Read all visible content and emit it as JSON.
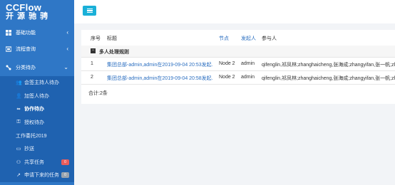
{
  "brand": {
    "line1": "CCFlow",
    "line2": "开 源 驰 骋"
  },
  "sidebar": {
    "top_items": [
      {
        "label": "基础功能",
        "icon": "grid-icon"
      },
      {
        "label": "流程查询",
        "icon": "search-flow-icon"
      },
      {
        "label": "分类待办",
        "icon": "flow-icon"
      }
    ],
    "sub_items": [
      {
        "label": "会签主持人待办",
        "icon": "user-group-icon"
      },
      {
        "label": "加签人待办",
        "icon": "user-add-icon"
      },
      {
        "label": "协作待办",
        "icon": "link-icon"
      },
      {
        "label": "授权待办",
        "icon": "key-icon"
      },
      {
        "label": "工作委托2019",
        "icon": ""
      },
      {
        "label": "抄送",
        "icon": "copy-icon"
      },
      {
        "label": "共享任务",
        "icon": "share-icon",
        "badge": "0",
        "badge_color": "#e85c5c"
      },
      {
        "label": "申请下来的任务",
        "icon": "chart-icon",
        "badge": "0",
        "badge_color": "#9aa3ad"
      }
    ]
  },
  "table": {
    "headers": {
      "no": "序号",
      "title": "标题",
      "node": "节点",
      "starter": "发起人",
      "participants": "参与人"
    },
    "group_label": "多人处理规则",
    "rows": [
      {
        "no": "1",
        "title": "集团总部-admin,admin在2019-09-04 20:53发起.",
        "node": "Node 2",
        "starter": "admin",
        "participants": "qifenglin,祁凤林;zhanghaicheng,张海成;zhangyifan,张一帆;zhou"
      },
      {
        "no": "2",
        "title": "集团总部-admin,admin在2019-09-04 20:58发起.",
        "node": "Node 2",
        "starter": "admin",
        "participants": "qifenglin,祁凤林;zhanghaicheng,张海成;zhangyifan,张一帆;zhou"
      }
    ],
    "total": "合计:2条"
  }
}
